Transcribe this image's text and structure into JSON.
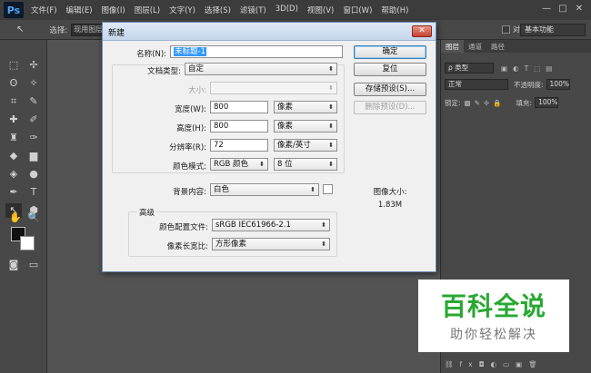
{
  "app": {
    "logo": "Ps",
    "menus": [
      "文件(F)",
      "编辑(E)",
      "图像(I)",
      "图层(L)",
      "文字(Y)",
      "选择(S)",
      "滤镜(T)",
      "3D(D)",
      "视图(V)",
      "窗口(W)",
      "帮助(H)"
    ],
    "window_controls": {
      "minimize": "—",
      "restore": "□",
      "close": "✕"
    }
  },
  "options_bar": {
    "select_label": "选择:",
    "select_value": "现用图层",
    "checkbox_label": "对",
    "workspace": "基本功能"
  },
  "right_panel": {
    "tabs": [
      "图层",
      "通道",
      "路径"
    ],
    "kind_label": "ρ 类型",
    "blend_mode": "正常",
    "opacity_label": "不透明度:",
    "opacity_value": "100%",
    "lock_label": "锁定:",
    "fill_label": "填充:",
    "fill_value": "100%"
  },
  "dialog": {
    "title": "新建",
    "close_label": "✕",
    "name_label": "名称(N):",
    "name_value": "未标题-1",
    "preset_label": "文档类型:",
    "preset_value": "自定",
    "size_label": "大小:",
    "size_value": "",
    "width_label": "宽度(W):",
    "width_value": "800",
    "width_unit": "像素",
    "height_label": "高度(H):",
    "height_value": "800",
    "height_unit": "像素",
    "resolution_label": "分辨率(R):",
    "resolution_value": "72",
    "resolution_unit": "像素/英寸",
    "color_mode_label": "颜色模式:",
    "color_mode_value": "RGB 颜色",
    "bit_depth_value": "8 位",
    "background_label": "背景内容:",
    "background_value": "白色",
    "advanced_title": "高级",
    "color_profile_label": "颜色配置文件:",
    "color_profile_value": "sRGB IEC61966-2.1",
    "pixel_aspect_label": "像素长宽比:",
    "pixel_aspect_value": "方形像素",
    "buttons": {
      "ok": "确定",
      "reset": "复位",
      "save_preset": "存储预设(S)...",
      "delete_preset": "删除预设(D)..."
    },
    "image_size_label": "图像大小:",
    "image_size_value": "1.83M"
  },
  "watermark": {
    "title": "百科全说",
    "subtitle": "助你轻松解决"
  },
  "colors": {
    "accent": "#3398ff",
    "watermark_green": "#29a832"
  }
}
